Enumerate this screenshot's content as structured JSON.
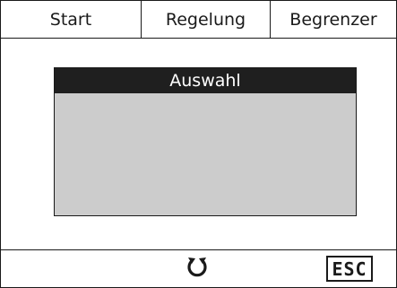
{
  "tabs": [
    {
      "label": "Start"
    },
    {
      "label": "Regelung"
    },
    {
      "label": "Begrenzer"
    }
  ],
  "dialog": {
    "title": "Auswahl"
  },
  "footer": {
    "left_icon": "refresh-icon",
    "esc_label": "ESC"
  },
  "colors": {
    "background": "#ffffff",
    "border": "#1a1a1a",
    "dialog_header": "#1f1f1f",
    "dialog_body": "#cccccc"
  }
}
